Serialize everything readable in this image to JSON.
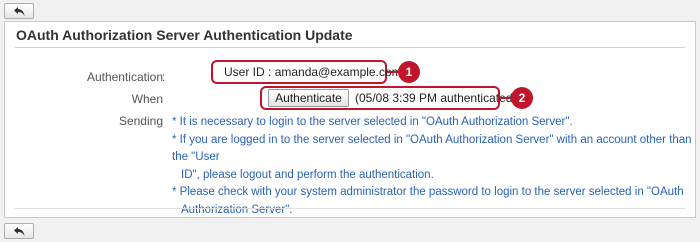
{
  "nav": {
    "back_icon": "back-arrow-icon"
  },
  "page": {
    "title": "OAuth Authorization Server Authentication Update"
  },
  "field": {
    "label_line1": "Authentication When",
    "label_line2": "Sending",
    "colon": ":",
    "user_id_label": "User ID",
    "user_id_sep": ":",
    "user_id_value": "amanda@example.com",
    "authenticate_button": "Authenticate",
    "status": "(05/08 3:39 PM authenticated)"
  },
  "callouts": {
    "first": "1",
    "second": "2",
    "color": "#c0152b"
  },
  "notes": {
    "note1": "* It is necessary to login to the server selected in \"OAuth Authorization Server\".",
    "note2_line1": "* If you are logged in to the server selected in \"OAuth Authorization Server\" with an account other than the \"User",
    "note2_line2": "ID\", please logout and perform the authentication.",
    "note3_line1": "* Please check with your system administrator the password to login to the server selected in \"OAuth",
    "note3_line2": "Authorization Server\".",
    "color": "#2a62b8"
  }
}
